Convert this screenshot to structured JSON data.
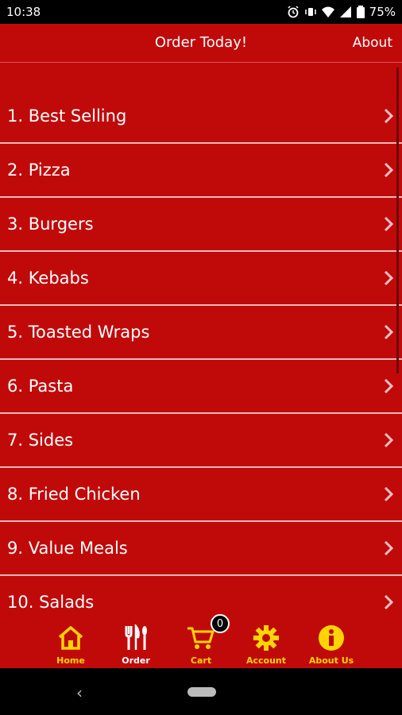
{
  "status_bar": {
    "time": "10:38",
    "battery": "75%"
  },
  "header": {
    "title": "Order Today!",
    "about_label": "About"
  },
  "categories": [
    "1. Best Selling",
    "2. Pizza",
    "3. Burgers",
    "4. Kebabs",
    "5. Toasted Wraps",
    "6. Pasta",
    "7. Sides",
    "8. Fried Chicken",
    "9. Value Meals",
    "10. Salads"
  ],
  "tabs": [
    {
      "label": "Home",
      "icon": "home-icon",
      "color": "yellow"
    },
    {
      "label": "Order",
      "icon": "cutlery-icon",
      "color": "white"
    },
    {
      "label": "Cart",
      "icon": "cart-icon",
      "color": "yellow",
      "badge": "0"
    },
    {
      "label": "Account",
      "icon": "gear-icon",
      "color": "yellow"
    },
    {
      "label": "About Us",
      "icon": "info-icon",
      "color": "yellow"
    }
  ],
  "colors": {
    "background": "#c00a0a",
    "accent": "#ffd400",
    "divider": "#e9b9b9"
  }
}
